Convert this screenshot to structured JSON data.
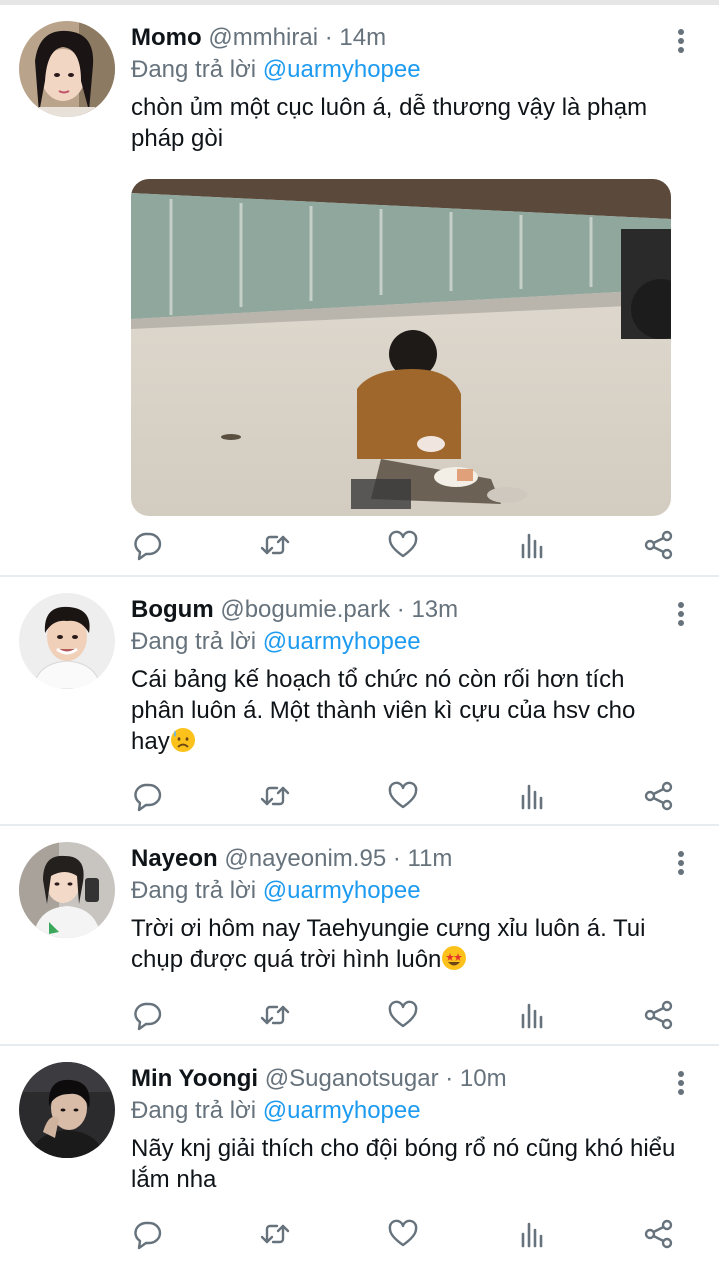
{
  "tweets": [
    {
      "name": "Momo",
      "handle": "@mmhirai",
      "dot": "·",
      "time": "14m",
      "reply_prefix": "Đang trả lời",
      "reply_to": "@uarmyhopee",
      "text": "chòn ủm một cục luôn á, dễ thương vậy là phạm pháp gòi",
      "emoji": "",
      "avatar_icon": "user-avatar",
      "has_media": true
    },
    {
      "name": "Bogum",
      "handle": "@bogumie.park",
      "dot": "·",
      "time": "13m",
      "reply_prefix": "Đang trả lời",
      "reply_to": "@uarmyhopee",
      "text": "Cái bảng kế hoạch tổ chức nó còn rối hơn tích phân luôn á. Một thành viên kì cựu của hsv cho hay",
      "emoji": "sad-sweat-face",
      "avatar_icon": "user-avatar",
      "has_media": false
    },
    {
      "name": "Nayeon",
      "handle": "@nayeonim.95",
      "dot": "·",
      "time": "11m",
      "reply_prefix": "Đang trả lời",
      "reply_to": "@uarmyhopee",
      "text": "Trời ơi hôm nay Taehyungie cưng xỉu luôn á. Tui chụp được quá trời hình luôn",
      "emoji": "star-struck-face",
      "avatar_icon": "user-avatar",
      "has_media": false
    },
    {
      "name": "Min Yoongi",
      "handle": "@Suganotsugar",
      "dot": "·",
      "time": "10m",
      "reply_prefix": "Đang trả lời",
      "reply_to": "@uarmyhopee",
      "text": "Nãy knj giải thích cho đội bóng rổ nó cũng khó hiểu lắm nha",
      "emoji": "",
      "avatar_icon": "user-avatar",
      "has_media": false
    }
  ],
  "action_icons": [
    "reply-icon",
    "retweet-icon",
    "like-icon",
    "analytics-icon",
    "share-icon"
  ],
  "colors": {
    "accent": "#1d9bf0",
    "secondary_text": "#66727c",
    "primary_text": "#0f1419",
    "divider": "#e6ecf0"
  }
}
